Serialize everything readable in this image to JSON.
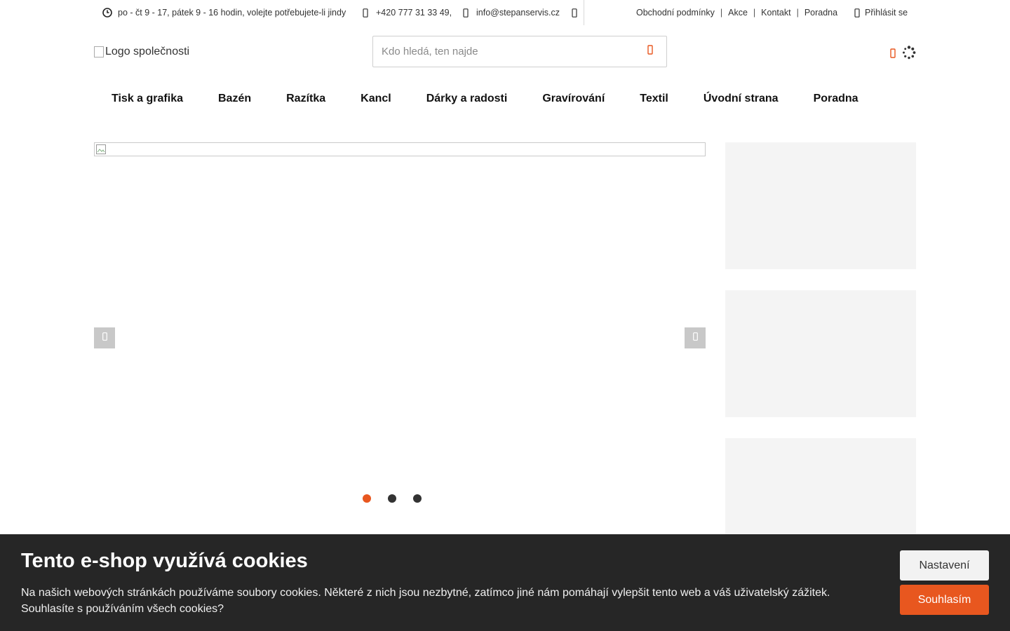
{
  "topbar": {
    "hours": "po - čt 9 - 17, pátek 9 - 16 hodin, volejte potřebujete-li jindy",
    "phone": "+420 777 31 33 49,",
    "email": "info@stepanservis.cz",
    "links": [
      "Obchodní podmínky",
      "Akce",
      "Kontakt",
      "Poradna"
    ],
    "login": "Přihlásit se"
  },
  "header": {
    "logo_alt": "Logo společnosti",
    "search_placeholder": "Kdo hledá, ten najde"
  },
  "nav": {
    "items": [
      "Tisk a grafika",
      "Bazén",
      "Razítka",
      "Kancl",
      "Dárky a radosti",
      "Gravírování",
      "Textil",
      "Úvodní strana",
      "Poradna"
    ]
  },
  "carousel": {
    "slide_count": 3,
    "active_slide": 1
  },
  "cookie": {
    "title": "Tento e-shop využívá cookies",
    "text": "Na našich webových stránkách používáme soubory cookies. Některé z nich jsou nezbytné, zatímco jiné nám pomáhají vylepšit tento web a váš uživatelský zážitek. Souhlasíte s používáním všech cookies?",
    "settings_label": "Nastavení",
    "accept_label": "Souhlasím"
  },
  "colors": {
    "accent": "#e8571f",
    "cookie_bg": "#262626",
    "banner_bg": "#f4f4f4"
  },
  "icons": {
    "hours": "clock-icon",
    "phone": "phone-icon",
    "email": "envelope-icon",
    "social": "facebook-icon",
    "login": "user-icon",
    "search": "search-icon",
    "cart": "cart-icon",
    "loading": "spinner-icon",
    "carousel_prev": "chevron-left-icon",
    "carousel_next": "chevron-right-icon"
  }
}
